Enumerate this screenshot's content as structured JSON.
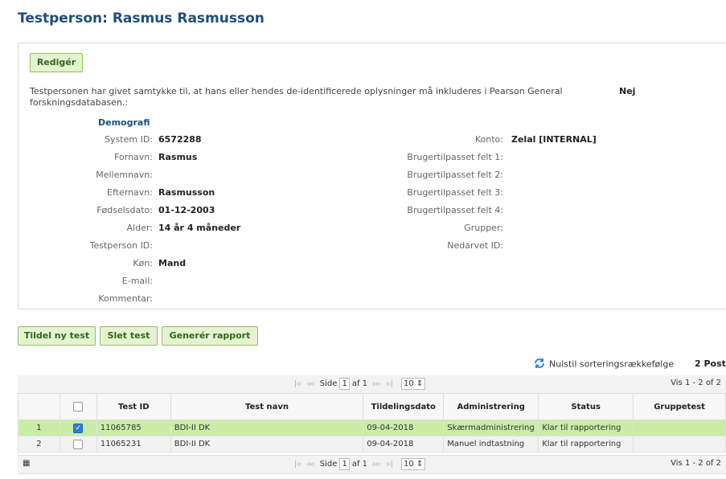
{
  "page": {
    "title": "Testperson: Rasmus Rasmusson"
  },
  "card": {
    "edit_label": "Redigér",
    "consent_text": "Testpersonen har givet samtykke til, at hans eller hendes de-identificerede oplysninger må inkluderes i Pearson General forskningsdatabasen.:",
    "consent_value": "Nej",
    "section_title": "Demografi",
    "left_fields": [
      {
        "label": "System ID:",
        "value": "6572288"
      },
      {
        "label": "Fornavn:",
        "value": "Rasmus"
      },
      {
        "label": "Mellemnavn:",
        "value": ""
      },
      {
        "label": "Efternavn:",
        "value": "Rasmusson"
      },
      {
        "label": "Fødselsdato:",
        "value": "01-12-2003"
      },
      {
        "label": "Alder:",
        "value": "14 år 4 måneder"
      },
      {
        "label": "Testperson ID:",
        "value": ""
      },
      {
        "label": "Køn:",
        "value": "Mand"
      },
      {
        "label": "E-mail:",
        "value": ""
      },
      {
        "label": "Kommentar:",
        "value": ""
      }
    ],
    "right_fields": [
      {
        "label": "Konto:",
        "value": "Zelal [INTERNAL]"
      },
      {
        "label": "Brugertilpasset felt 1:",
        "value": ""
      },
      {
        "label": "Brugertilpasset felt 2:",
        "value": ""
      },
      {
        "label": "Brugertilpasset felt 3:",
        "value": ""
      },
      {
        "label": "Brugertilpasset felt 4:",
        "value": ""
      },
      {
        "label": "Grupper:",
        "value": ""
      },
      {
        "label": "Nedarvet ID:",
        "value": ""
      }
    ]
  },
  "actions": {
    "assign_label": "Tildel ny test",
    "delete_label": "Slet test",
    "report_label": "Generér rapport"
  },
  "grid": {
    "reset_label": "Nulstil sorteringsrækkefølge",
    "posts_label": "2 Post",
    "pager": {
      "first": "|◃",
      "prev": "◃◃",
      "page_label": "Side",
      "page_value": "1",
      "of_label": "af 1",
      "next": "▹▹",
      "last": "▹|",
      "rows": "10",
      "rows_arrow": "⇕"
    },
    "records_label": "Vis 1 - 2 of 2",
    "columns": [
      "",
      "",
      "Test ID",
      "Test navn",
      "Tildelingsdato",
      "Administrering",
      "Status",
      "Gruppetest"
    ],
    "rows": [
      {
        "num": "1",
        "checked": true,
        "id": "11065785",
        "name": "BDI-II DK",
        "date": "09-04-2018",
        "admin": "Skærmadministrering",
        "status": "Klar til rapportering",
        "group": ""
      },
      {
        "num": "2",
        "checked": false,
        "id": "11065231",
        "name": "BDI-II DK",
        "date": "09-04-2018",
        "admin": "Manuel indtastning",
        "status": "Klar til rapportering",
        "group": ""
      }
    ],
    "footer_icon": "grid-menu-icon"
  }
}
